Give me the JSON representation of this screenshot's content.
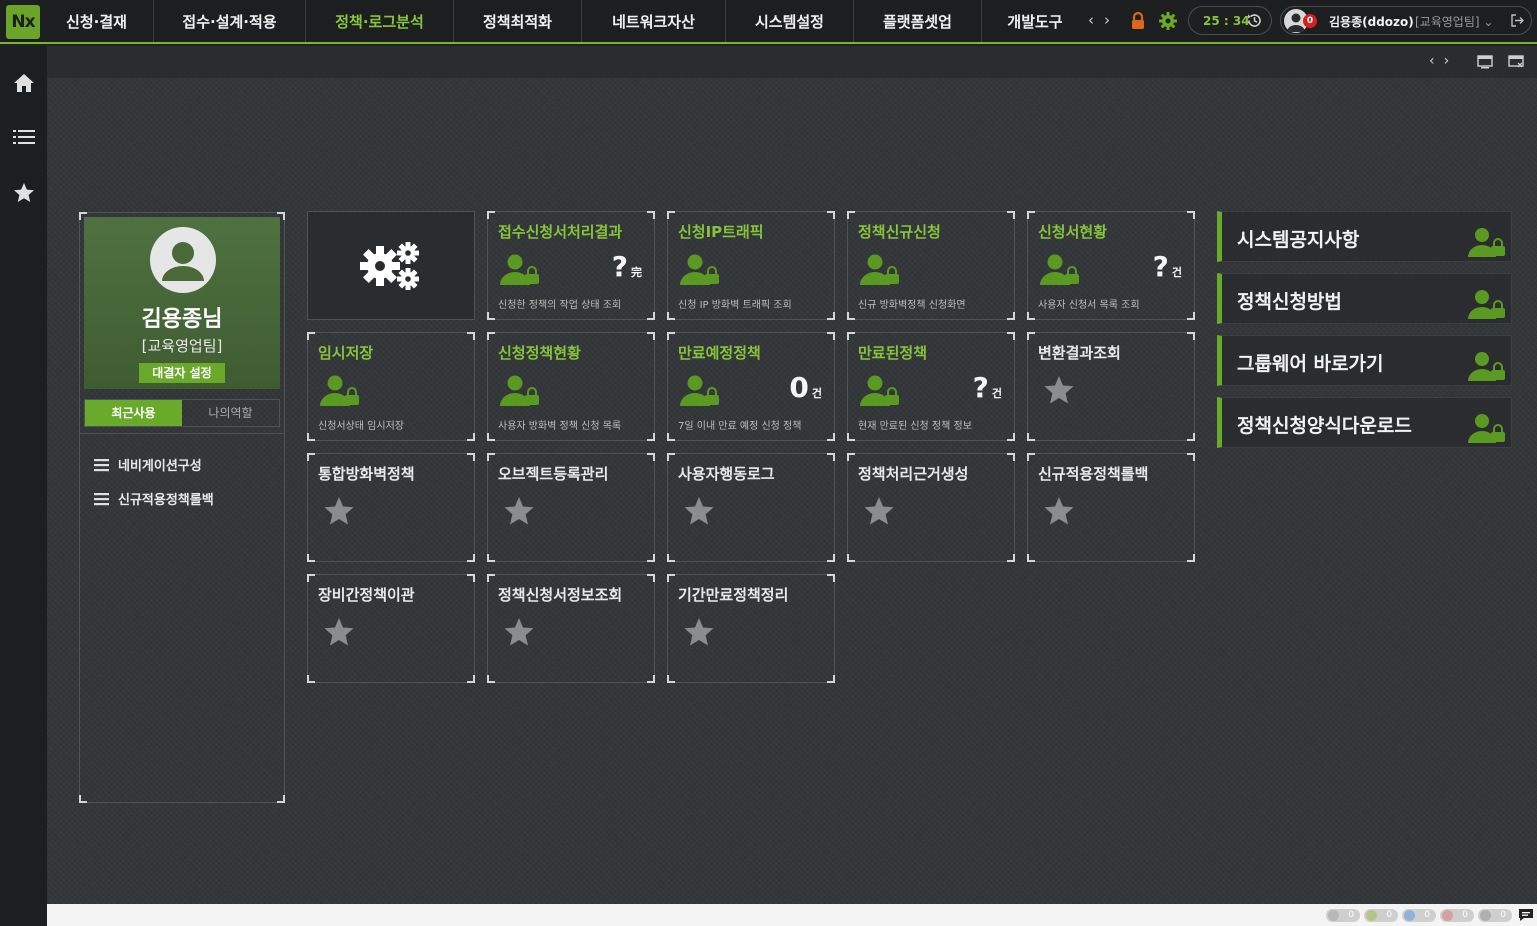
{
  "app": {
    "logo": "Nx"
  },
  "menu": {
    "items": [
      {
        "label": "신청·결재",
        "active": false
      },
      {
        "label": "접수·설계·적용",
        "active": false
      },
      {
        "label": "정책·로그분석",
        "active": true
      },
      {
        "label": "정책최적화",
        "active": false
      },
      {
        "label": "네트워크자산",
        "active": false
      },
      {
        "label": "시스템설정",
        "active": false
      },
      {
        "label": "플랫폼셋업",
        "active": false
      },
      {
        "label": "개발도구",
        "active": false
      }
    ],
    "prev_arrow": "‹",
    "next_arrow": "›"
  },
  "header": {
    "timer": "25 : 34",
    "notification_count": "0",
    "user_name": "김용종(ddozo)",
    "user_team": "[교육영업팀]",
    "user_dropdown": "⌄"
  },
  "rail": {
    "icons": [
      "home-icon",
      "list-icon",
      "star-icon"
    ]
  },
  "subbar": {
    "prev_arrow": "‹",
    "next_arrow": "›"
  },
  "profile": {
    "name": "김용종님",
    "team": "[교육영업팀]",
    "approver_button": "대결자 설정",
    "tabs": [
      "최근사용",
      "나의역할"
    ],
    "links": [
      "네비게이션구성",
      "신규적용정책롤백"
    ]
  },
  "tiles": [
    {
      "title": "접수신청서처리결과",
      "desc": "신청한 정책의 작업 상태 조회",
      "count": "?",
      "unit": "完",
      "style": "green"
    },
    {
      "title": "신청IP트래픽",
      "desc": "신청 IP 방화벽 트래픽 조회",
      "count": "",
      "unit": "",
      "style": "green"
    },
    {
      "title": "정책신규신청",
      "desc": "신규 방화벽정책 신청화면",
      "count": "",
      "unit": "",
      "style": "green"
    },
    {
      "title": "신청서현황",
      "desc": "사용자 신청서 목록 조회",
      "count": "?",
      "unit": "건",
      "style": "green"
    },
    {
      "title": "임시저장",
      "desc": "신청서상태 임시저장",
      "count": "",
      "unit": "",
      "style": "green"
    },
    {
      "title": "신청정책현황",
      "desc": "사용자 방화벽 정책 신청 목록",
      "count": "",
      "unit": "",
      "style": "green"
    },
    {
      "title": "만료예정정책",
      "desc": "7일 이내 만료 예정 신청 정책",
      "count": "0",
      "unit": "건",
      "style": "green"
    },
    {
      "title": "만료된정책",
      "desc": "현재 만료된 신청 정책 정보",
      "count": "?",
      "unit": "건",
      "style": "green"
    },
    {
      "title": "변환결과조회",
      "desc": "",
      "count": "",
      "unit": "",
      "style": "gray"
    },
    {
      "title": "통합방화벽정책",
      "desc": "",
      "count": "",
      "unit": "",
      "style": "gray"
    },
    {
      "title": "오브젝트등록관리",
      "desc": "",
      "count": "",
      "unit": "",
      "style": "gray"
    },
    {
      "title": "사용자행동로그",
      "desc": "",
      "count": "",
      "unit": "",
      "style": "gray"
    },
    {
      "title": "정책처리근거생성",
      "desc": "",
      "count": "",
      "unit": "",
      "style": "gray"
    },
    {
      "title": "신규적용정책롤백",
      "desc": "",
      "count": "",
      "unit": "",
      "style": "gray"
    },
    {
      "title": "장비간정책이관",
      "desc": "",
      "count": "",
      "unit": "",
      "style": "gray"
    },
    {
      "title": "정책신청서정보조회",
      "desc": "",
      "count": "",
      "unit": "",
      "style": "gray"
    },
    {
      "title": "기간만료정책정리",
      "desc": "",
      "count": "",
      "unit": "",
      "style": "gray"
    }
  ],
  "notices": [
    "시스템공지사항",
    "정책신청방법",
    "그룹웨어 바로가기",
    "정책신청양식다운로드"
  ],
  "statusbar": {
    "counts": [
      "0",
      "0",
      "0",
      "0",
      "0"
    ]
  },
  "colors": {
    "accent": "#86c43a",
    "brand": "#6aaa2a",
    "bg": "#34373a"
  }
}
